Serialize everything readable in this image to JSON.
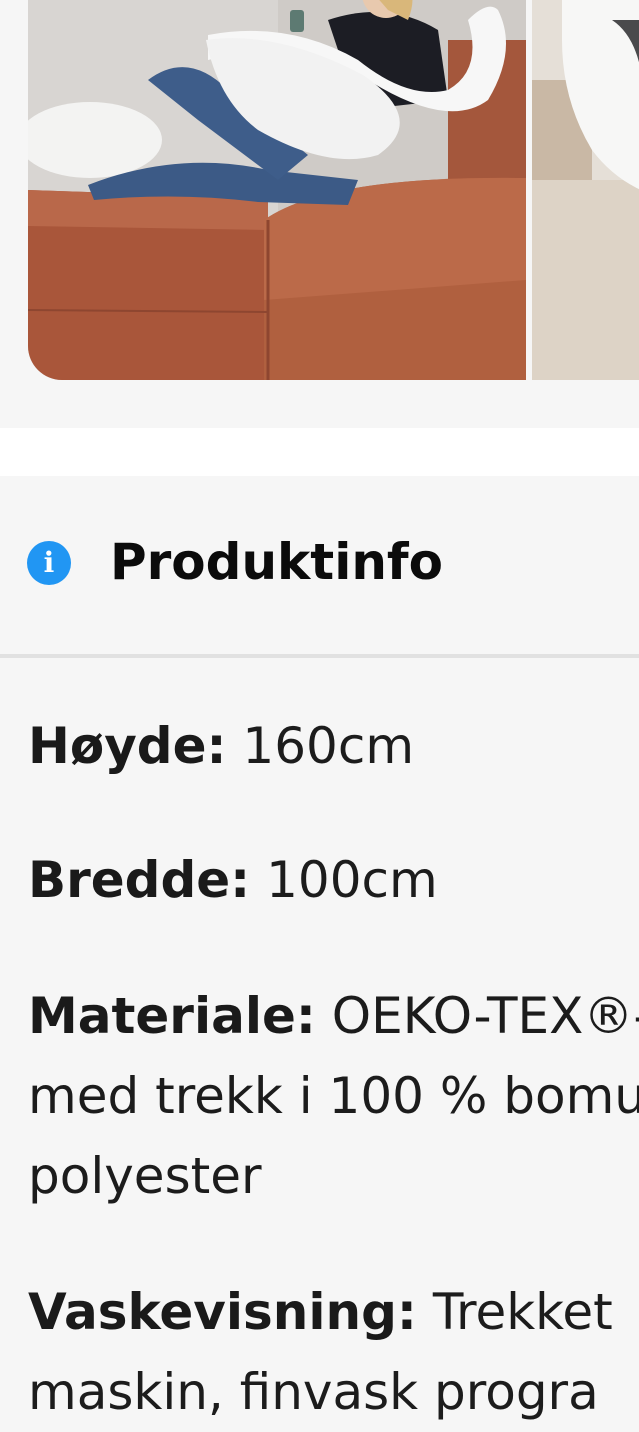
{
  "product_info": {
    "title": "Produktinfo",
    "icon": "info-icon"
  },
  "specs": {
    "hoyde": {
      "label": "Høyde:",
      "value": "160cm"
    },
    "bredde": {
      "label": "Bredde:",
      "value": "100cm"
    },
    "materiale": {
      "label": "Materiale:",
      "line1": "OEKO-TEX®-",
      "line2": "med trekk i 100 % bomu",
      "line3": "polyester"
    },
    "vaskevisning": {
      "label": "Vaskevisning:",
      "line1": "Trekket",
      "line2": "maskin, finvask progra"
    }
  },
  "colors": {
    "accent": "#2196f3",
    "background": "#f6f6f6",
    "divider": "#e1e1e1",
    "text": "#1c1c1c"
  }
}
